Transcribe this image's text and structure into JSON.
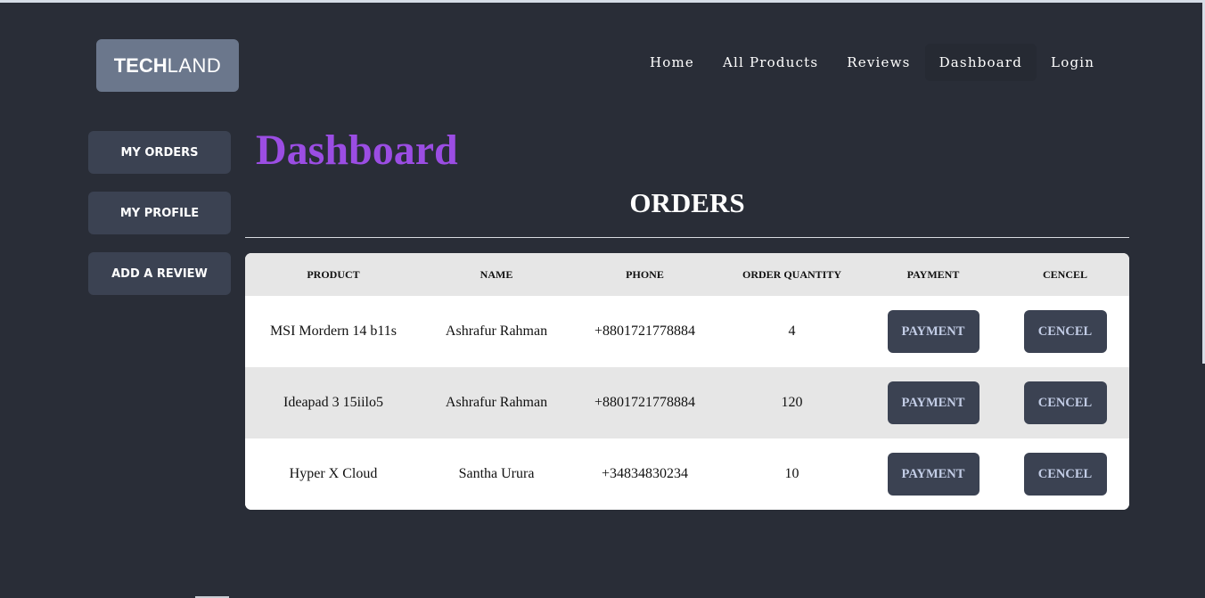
{
  "brand": {
    "logo_bold": "TECH",
    "logo_light": "LAND"
  },
  "nav": {
    "items": [
      {
        "label": "Home",
        "active": false
      },
      {
        "label": "All Products",
        "active": false
      },
      {
        "label": "Reviews",
        "active": false
      },
      {
        "label": "Dashboard",
        "active": true
      },
      {
        "label": "Login",
        "active": false
      }
    ]
  },
  "sidebar": {
    "items": [
      {
        "label": "MY ORDERS"
      },
      {
        "label": "MY PROFILE"
      },
      {
        "label": "ADD A REVIEW"
      }
    ]
  },
  "page": {
    "title": "Dashboard",
    "section_title": "ORDERS"
  },
  "table": {
    "headers": [
      "PRODUCT",
      "NAME",
      "PHONE",
      "ORDER QUANTITY",
      "PAYMENT",
      "CENCEL"
    ],
    "rows": [
      {
        "product": "MSI Mordern 14 b11s",
        "name": "Ashrafur Rahman",
        "phone": "+8801721778884",
        "quantity": "4",
        "payment_label": "PAYMENT",
        "cancel_label": "CENCEL"
      },
      {
        "product": "Ideapad 3 15iilo5",
        "name": "Ashrafur Rahman",
        "phone": "+8801721778884",
        "quantity": "120",
        "payment_label": "PAYMENT",
        "cancel_label": "CENCEL"
      },
      {
        "product": "Hyper X Cloud",
        "name": "Santha Urura",
        "phone": "+34834830234",
        "quantity": "10",
        "payment_label": "PAYMENT",
        "cancel_label": "CENCEL"
      }
    ]
  },
  "colors": {
    "background": "#292d37",
    "title_accent": "#9b4de3",
    "button_bg": "#3b4252",
    "logo_bg": "#6b778c"
  }
}
